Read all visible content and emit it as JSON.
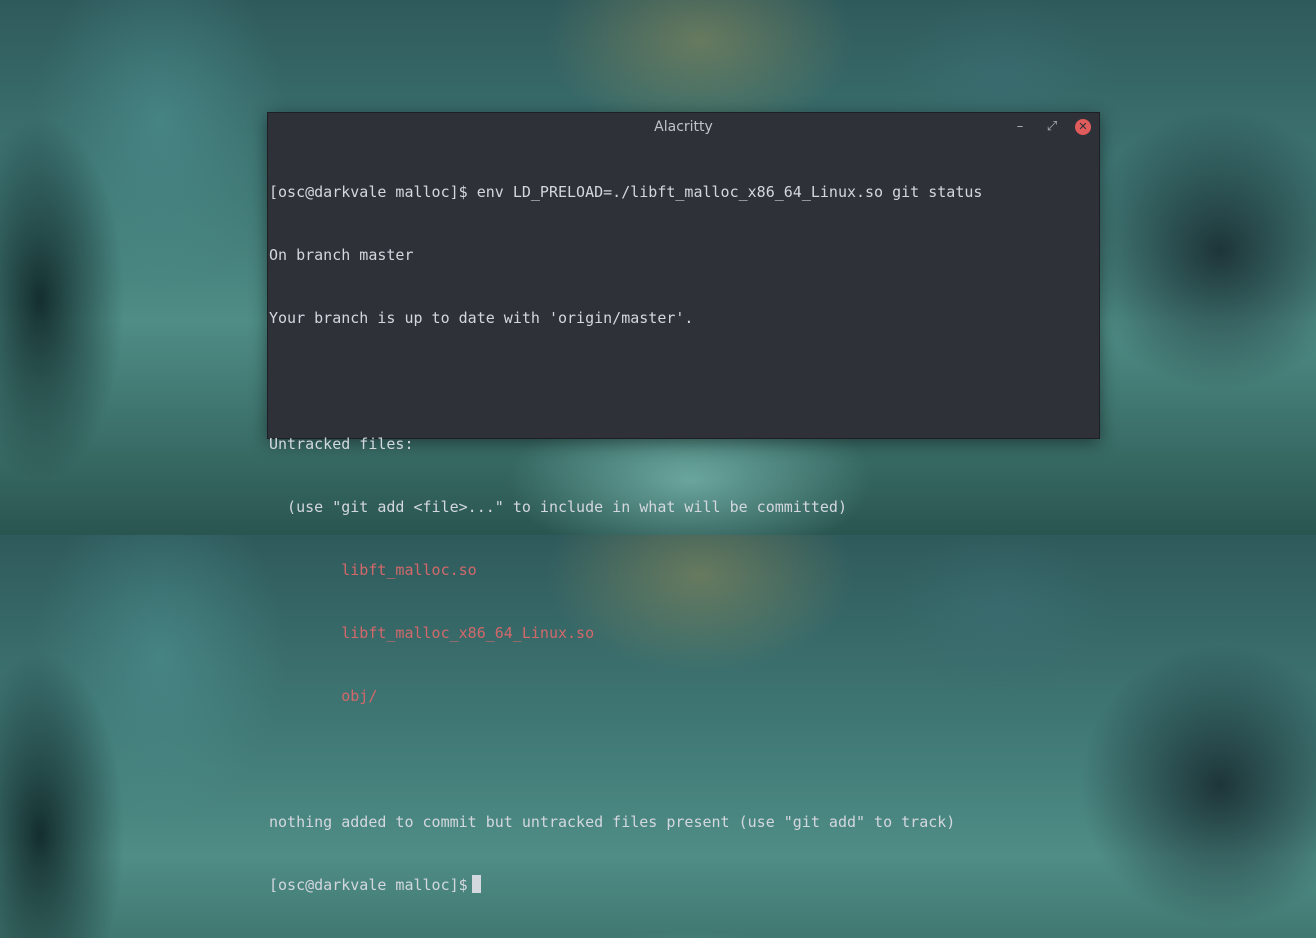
{
  "window": {
    "title": "Alacritty",
    "controls": {
      "minimize": "–",
      "maximize": "⤢",
      "close": "✕"
    }
  },
  "terminal": {
    "lines": [
      "[osc@darkvale malloc]$ env LD_PRELOAD=./libft_malloc_x86_64_Linux.so git status",
      "On branch master",
      "Your branch is up to date with 'origin/master'.",
      "",
      "Untracked files:",
      "  (use \"git add <file>...\" to include in what will be committed)",
      "        libft_malloc.so",
      "        libft_malloc_x86_64_Linux.so",
      "        obj/",
      "",
      "nothing added to commit but untracked files present (use \"git add\" to track)"
    ],
    "prompt": "[osc@darkvale malloc]$"
  },
  "colors": {
    "terminal_bg": "#2e3138",
    "text": "#d3d7de",
    "untracked": "#d2686a",
    "close_button": "#e05b5b"
  }
}
